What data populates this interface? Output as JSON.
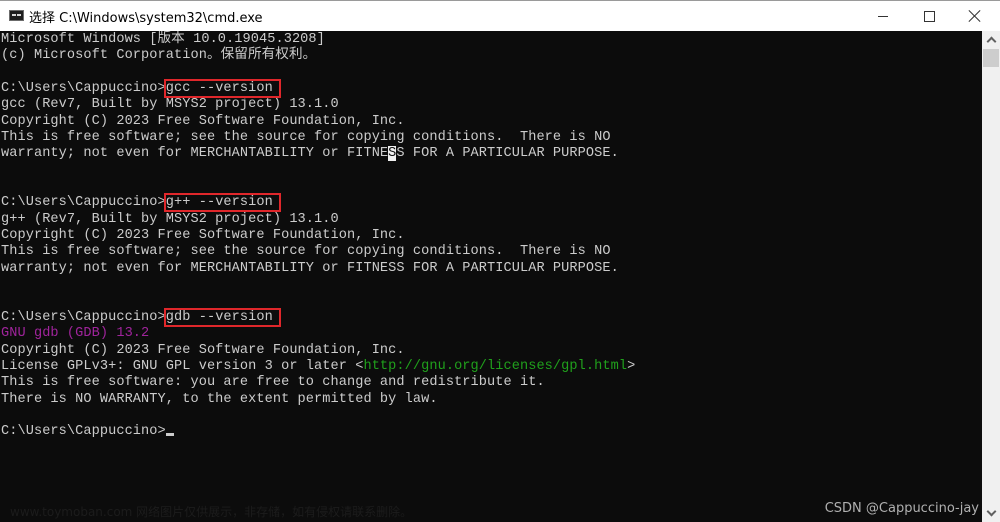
{
  "window": {
    "title": "选择 C:\\Windows\\system32\\cmd.exe",
    "icon": "console-app-icon",
    "controls": {
      "minimize": "minimize-icon",
      "maximize": "maximize-icon",
      "close": "close-icon"
    }
  },
  "console": {
    "colors": {
      "background": "#0c0c0c",
      "text": "#cccccc",
      "highlight_box": "#e0272b",
      "gdb_banner": "#a0249c",
      "url": "#20a01c"
    },
    "banner": [
      "Microsoft Windows [版本 10.0.19045.3208]",
      "(c) Microsoft Corporation。保留所有权利。"
    ],
    "prompt": "C:\\Users\\Cappuccino>",
    "blocks": [
      {
        "command": "gcc --version",
        "output": [
          "gcc (Rev7, Built by MSYS2 project) 13.1.0",
          "Copyright (C) 2023 Free Software Foundation, Inc.",
          "This is free software; see the source for copying conditions.  There is NO"
        ],
        "last_line": {
          "before": "warranty; not even for MERCHANTABILITY or FITNE",
          "selected": "S",
          "after": "S FOR A PARTICULAR PURPOSE."
        }
      },
      {
        "command": "g++ --version",
        "output": [
          "g++ (Rev7, Built by MSYS2 project) 13.1.0",
          "Copyright (C) 2023 Free Software Foundation, Inc.",
          "This is free software; see the source for copying conditions.  There is NO",
          "warranty; not even for MERCHANTABILITY or FITNESS FOR A PARTICULAR PURPOSE."
        ]
      },
      {
        "command": "gdb --version",
        "banner": "GNU gdb (GDB) 13.2",
        "copyright": "Copyright (C) 2023 Free Software Foundation, Inc.",
        "license_prefix": "License GPLv3+: GNU GPL version 3 or later <",
        "license_url": "http://gnu.org/licenses/gpl.html",
        "license_suffix": ">",
        "output": [
          "This is free software: you are free to change and redistribute it.",
          "There is NO WARRANTY, to the extent permitted by law."
        ]
      }
    ],
    "final_prompt": "C:\\Users\\Cappuccino>"
  },
  "watermarks": {
    "csdn": "CSDN @Cappuccino-jay",
    "bottom": "www.toymoban.com 网络图片仅供展示，非存储，如有侵权请联系删除。"
  }
}
